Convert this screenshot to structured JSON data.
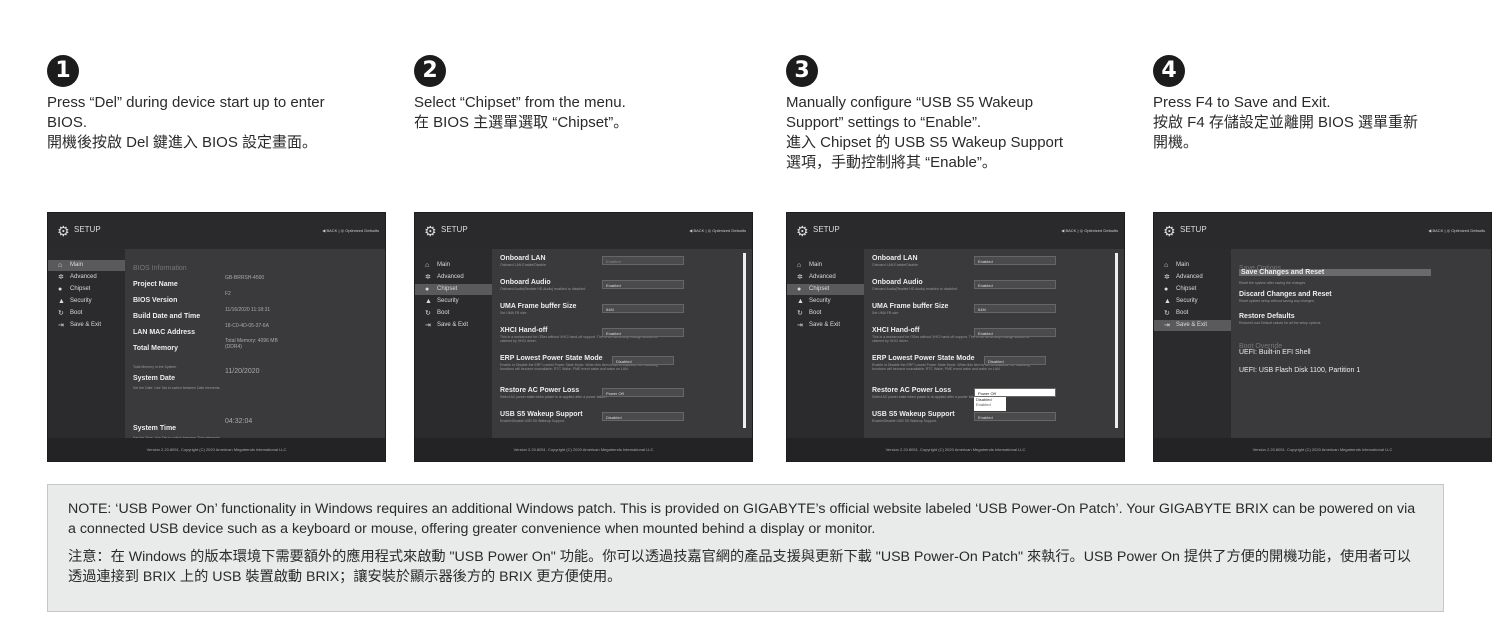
{
  "steps": [
    {
      "num": "1",
      "en": "Press “Del” during device start up to enter\nBIOS.",
      "zh": "開機後按啟 Del 鍵進入 BIOS 設定畫面。"
    },
    {
      "num": "2",
      "en": "Select “Chipset” from the menu.",
      "zh": "在 BIOS 主選單選取 “Chipset”。"
    },
    {
      "num": "3",
      "en": "Manually configure “USB S5 Wakeup\nSupport” settings to “Enable”.",
      "zh": "進入 Chipset 的 USB S5 Wakeup Support\n選項，手動控制將其 “Enable”。"
    },
    {
      "num": "4",
      "en": "Press F4 to Save and Exit.",
      "zh": "按啟 F4 存儲設定並離開 BIOS 選單重新\n開機。"
    }
  ],
  "bios": {
    "title": "SETUP",
    "topright": "◀ BACK | ◎ Optimized Defaults",
    "footer": "Version 2.20.8051. Copyright (C) 2020 American Megatrends International LLC",
    "menu": [
      "Main",
      "Advanced",
      "Chipset",
      "Security",
      "Boot",
      "Save & Exit"
    ],
    "main_info": {
      "heading": "BIOS Information",
      "project_name_label": "Project Name",
      "project_name": "GB-BRRSH-4500",
      "bios_version_label": "BIOS Version",
      "bios_version": "F2",
      "build_label": "Build Date and Time",
      "build": "11/16/2020 11:18:31",
      "mac_label": "LAN MAC Address",
      "mac": "18-C0-4D-05-37-6A",
      "memory_label": "Total Memory",
      "memory": "Total Memory: 4096 MB (DDR4)",
      "memory_desc": "Total Memory in the System.",
      "date_label": "System Date",
      "date": "11/20/2020",
      "date_desc": "Set the Date. Use Tab to switch between Date elements.",
      "time_label": "System Time",
      "time": "04:32:04",
      "time_desc": "Set the Time. Use Tab to switch between Time elements."
    },
    "chipset": {
      "onboard_lan": "Onboard LAN",
      "onboard_lan_desc": "Onboard LAN Enable/Disable",
      "onboard_audio": "Onboard Audio",
      "onboard_audio_desc": "Onboard Audio(Realtek HD Audio) enabled or disabled.",
      "uma": "UMA Frame buffer Size",
      "uma_desc": "Set UMA FB size",
      "uma_val": "64M",
      "xhci": "XHCI Hand-off",
      "xhci_desc": "This is a workaround for OSes without XHCI hand-off support. The XHCI ownership change should be claimed by XHCI driver.",
      "erp": "ERP Lowest Power State Mode",
      "erp_desc": "Enable or Disable the ERP Lowest Power State Mode. When this item is set to Disabled, the following functions will become unavailable: RTC Wake, PME event wake and wake on LAN.",
      "restore": "Restore AC Power Loss",
      "restore_desc": "Select AC power state when power is re-applied after a power failure.",
      "usb_s5": "USB S5 Wakeup Support",
      "usb_s5_desc": "Enable/Disable USB S5 Wakeup Support.",
      "enabled": "Enabled",
      "disabled": "Disabled",
      "power_off": "Power Off"
    },
    "save_exit": {
      "heading": "Save Options",
      "save_reset": "Save Changes and Reset",
      "save_reset_desc": "Reset the system after saving the changes.",
      "discard_reset": "Discard Changes and Reset",
      "discard_reset_desc": "Reset system setup without saving any changes.",
      "restore_defaults": "Restore Defaults",
      "restore_defaults_desc": "Restore/Load Default values for all the setup options.",
      "boot_override": "Boot Override",
      "uefi_shell": "UEFI: Built-in EFI Shell",
      "uefi_usb": "UEFI: USB Flash Disk 1100, Partition 1"
    }
  },
  "note": {
    "en": "NOTE: ‘USB Power On’ functionality in Windows requires an additional Windows patch. This is provided on GIGABYTE’s official website labeled ‘USB Power-On Patch’. Your GIGABYTE BRIX can be powered on via a connected USB device such as a keyboard or mouse, offering greater convenience when mounted behind a display or monitor.",
    "zh": "注意：在 Windows 的版本環境下需要額外的應用程式來啟動 \"USB Power On\" 功能。你可以透過技嘉官網的產品支援與更新下載 \"USB Power-On Patch\" 來執行。USB Power On 提供了方便的開機功能，使用者可以透過連接到 BRIX 上的 USB 裝置啟動 BRIX；讓安裝於顯示器後方的 BRIX 更方便使用。"
  }
}
